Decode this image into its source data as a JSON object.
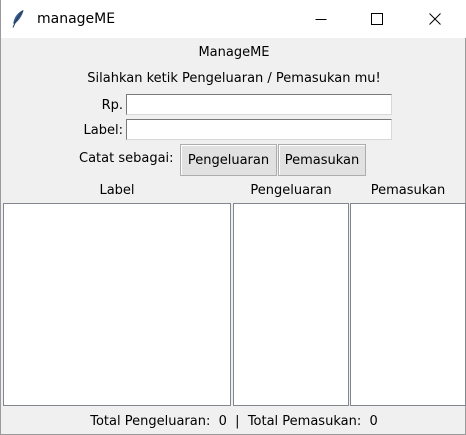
{
  "window": {
    "title": "manageME",
    "icon": "feather-icon",
    "controls": [
      "minimize-icon",
      "maximize-icon",
      "close-icon"
    ]
  },
  "app": {
    "heading": "ManageME",
    "instruction": "Silahkan ketik Pengeluaran / Pemasukan mu!"
  },
  "form": {
    "amount_label": "Rp.",
    "amount_value": "",
    "label_label": "Label:",
    "label_value": "",
    "record_as_label": "Catat sebagai:",
    "expense_button": "Pengeluaran",
    "income_button": "Pemasukan"
  },
  "columns": {
    "label": "Label",
    "expense": "Pengeluaran",
    "income": "Pemasukan"
  },
  "lists": {
    "label_items": [],
    "expense_items": [],
    "income_items": []
  },
  "totals": {
    "expense_label": "Total Pengeluaran:",
    "expense_value": "0",
    "separator": "|",
    "income_label": "Total Pemasukan:",
    "income_value": "0"
  }
}
